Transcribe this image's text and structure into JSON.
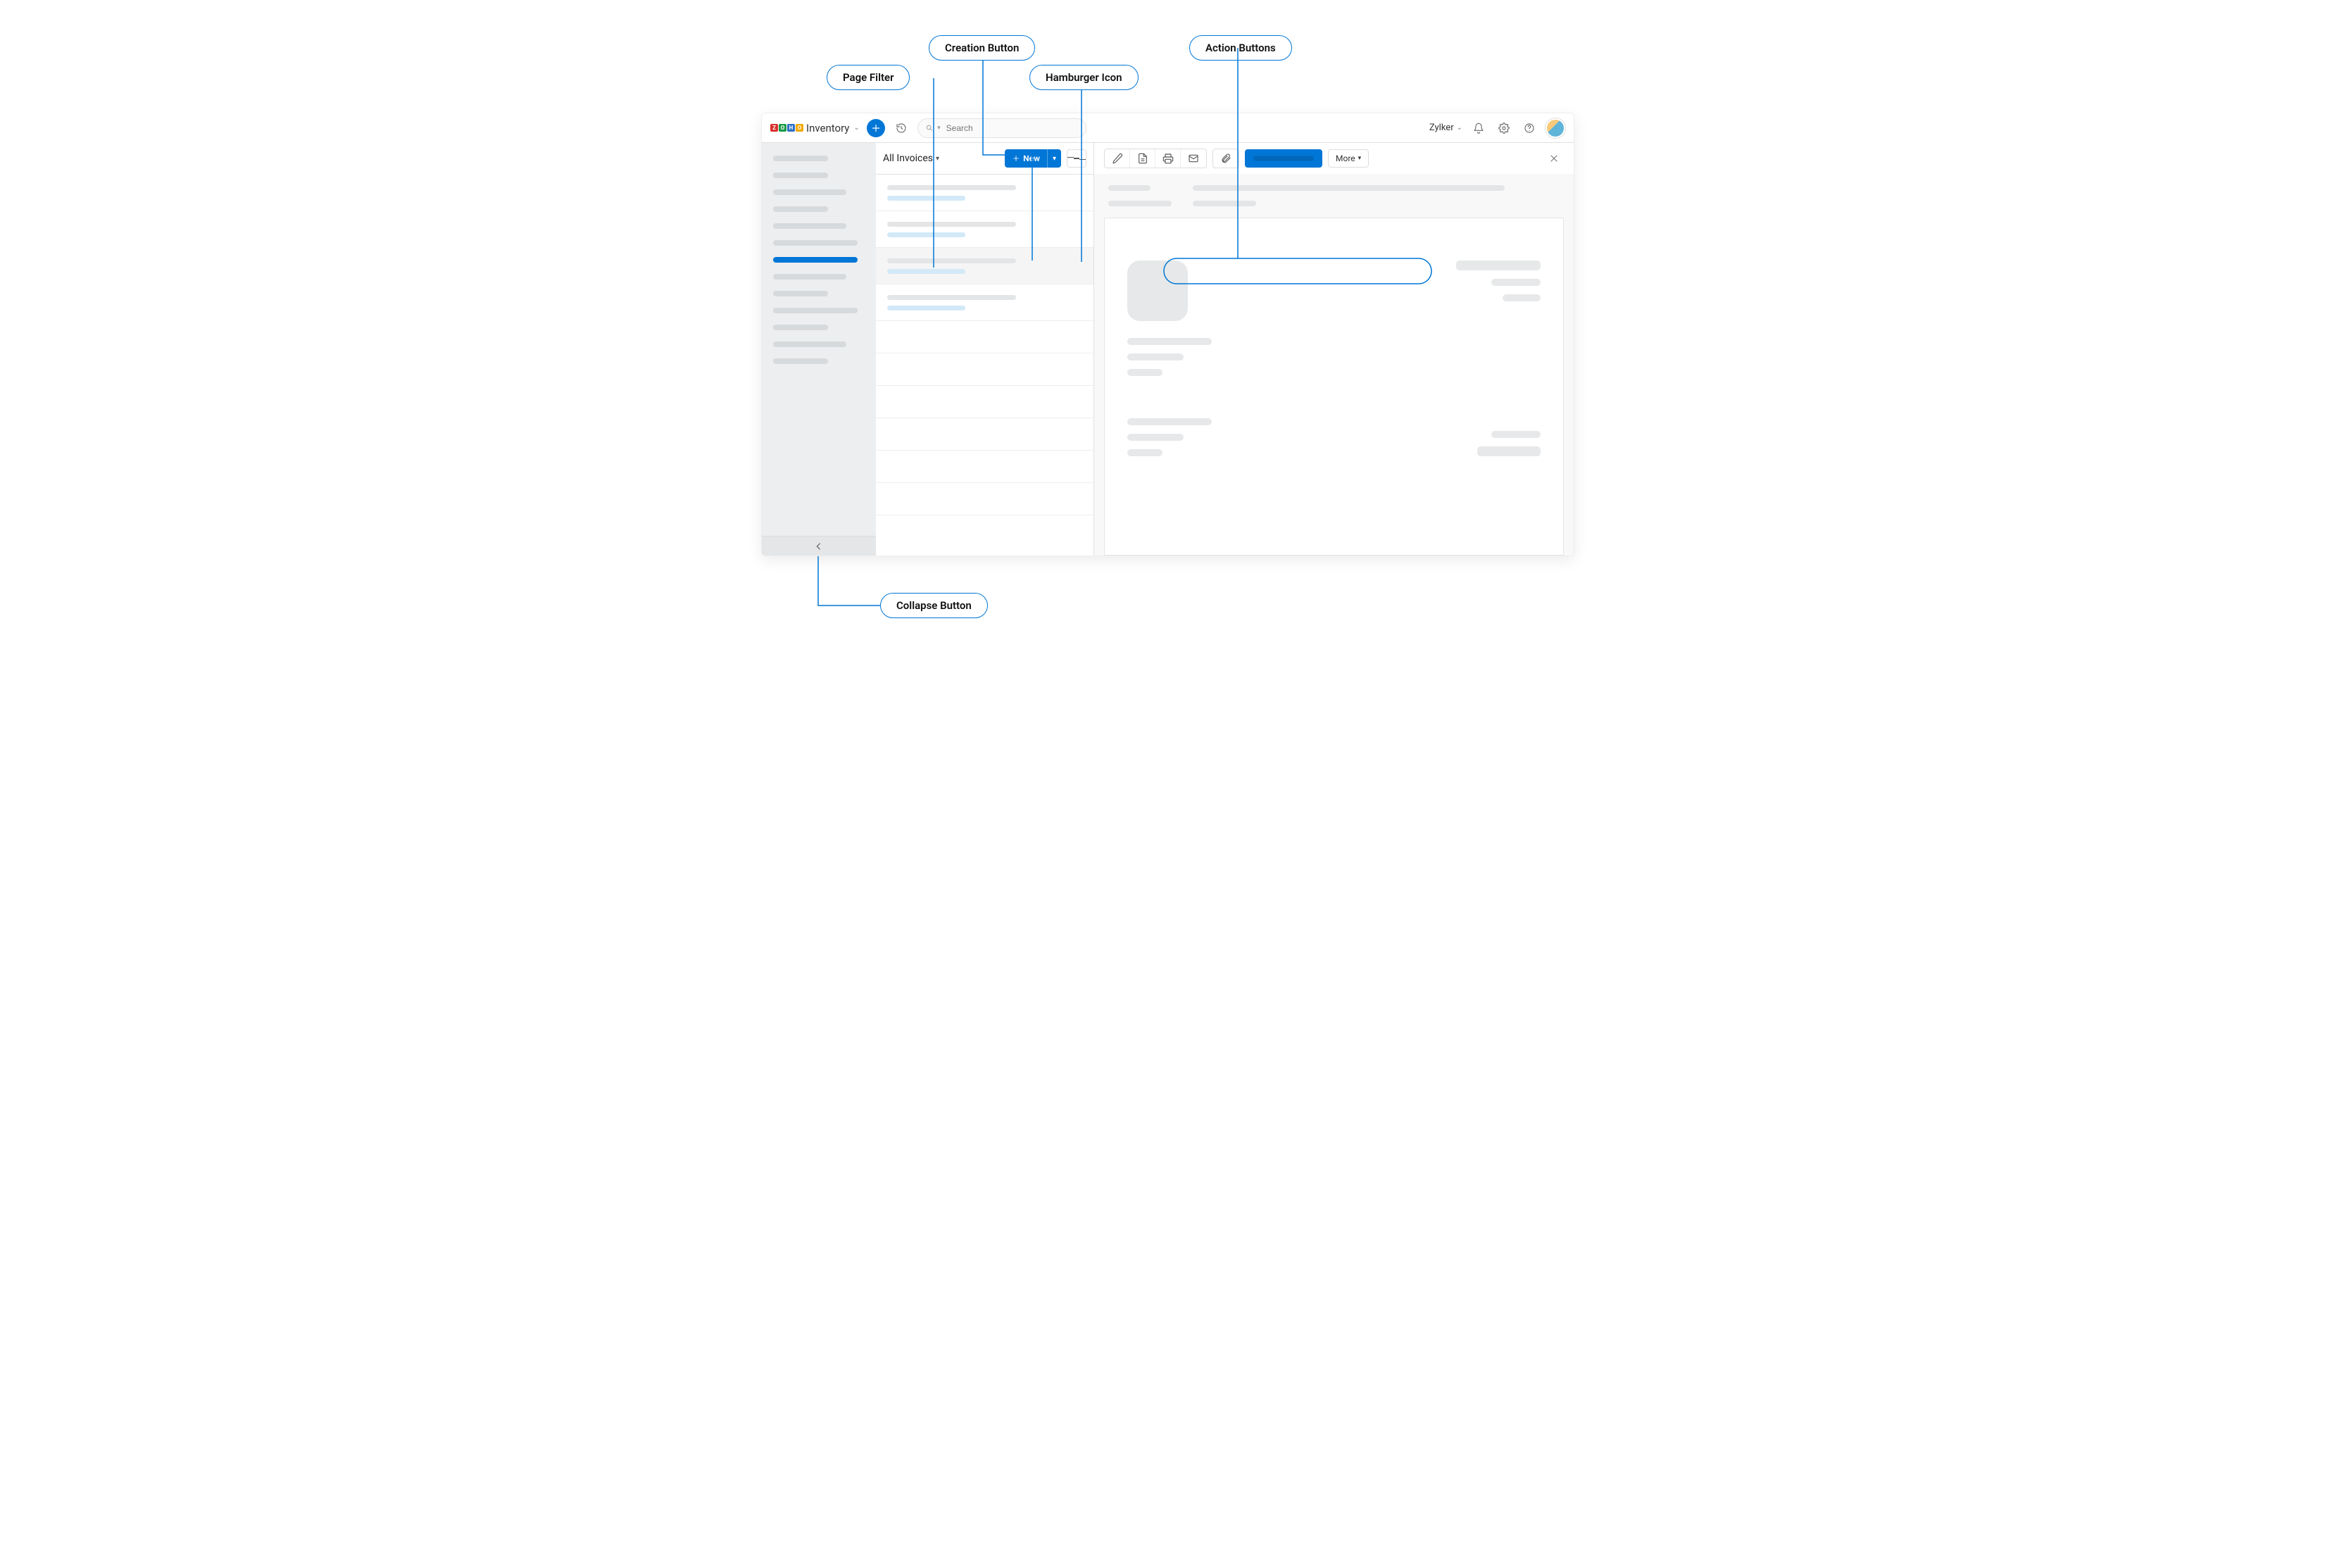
{
  "topbar": {
    "app_name": "Inventory",
    "search_placeholder": "Search",
    "org_name": "Zylker"
  },
  "listcol": {
    "filter_label": "All Invoices",
    "new_label": "New",
    "items": [
      {
        "filled": true,
        "selected": false
      },
      {
        "filled": true,
        "selected": false
      },
      {
        "filled": true,
        "selected": true
      },
      {
        "filled": true,
        "selected": false
      },
      {
        "filled": false,
        "selected": false
      },
      {
        "filled": false,
        "selected": false
      },
      {
        "filled": false,
        "selected": false
      },
      {
        "filled": false,
        "selected": false
      },
      {
        "filled": false,
        "selected": false
      },
      {
        "filled": false,
        "selected": false
      }
    ]
  },
  "detail": {
    "more_label": "More",
    "action_icons": [
      "edit",
      "pdf",
      "print",
      "mail"
    ],
    "attachment_icon": "attachment"
  },
  "callouts": {
    "page_filter": "Page Filter",
    "creation_button": "Creation Button",
    "hamburger_icon": "Hamburger Icon",
    "action_buttons": "Action Buttons",
    "collapse_button": "Collapse Button"
  }
}
